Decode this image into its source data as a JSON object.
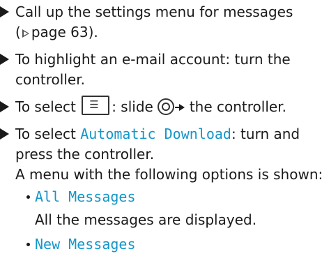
{
  "steps": [
    {
      "line1": "Call up the settings menu for messages",
      "line2_prefix": "(",
      "line2_ref": "page 63",
      "line2_suffix": ")."
    },
    {
      "line1": "To highlight an e-mail account: turn the",
      "line2": "controller."
    },
    {
      "text_before": "To select",
      "text_mid": ": slide",
      "text_after": "the controller."
    },
    {
      "text_before": "To select",
      "highlight": "Automatic Download",
      "text_after": ": turn and",
      "line2": "press the controller.",
      "line3": "A menu with the following options is shown:"
    }
  ],
  "options": [
    {
      "label": "All Messages",
      "description": "All the messages are displayed."
    },
    {
      "label": "New Messages"
    }
  ],
  "icons": {
    "bullet": "triangle-bullet-icon",
    "page_ref": "page-reference-triangle-icon",
    "settings_key": "list-settings-key-icon",
    "controller": "controller-knob-icon",
    "slide_arrow": "right-arrow-icon"
  },
  "colors": {
    "highlight": "#1496c8",
    "text": "#1a1a1a"
  }
}
